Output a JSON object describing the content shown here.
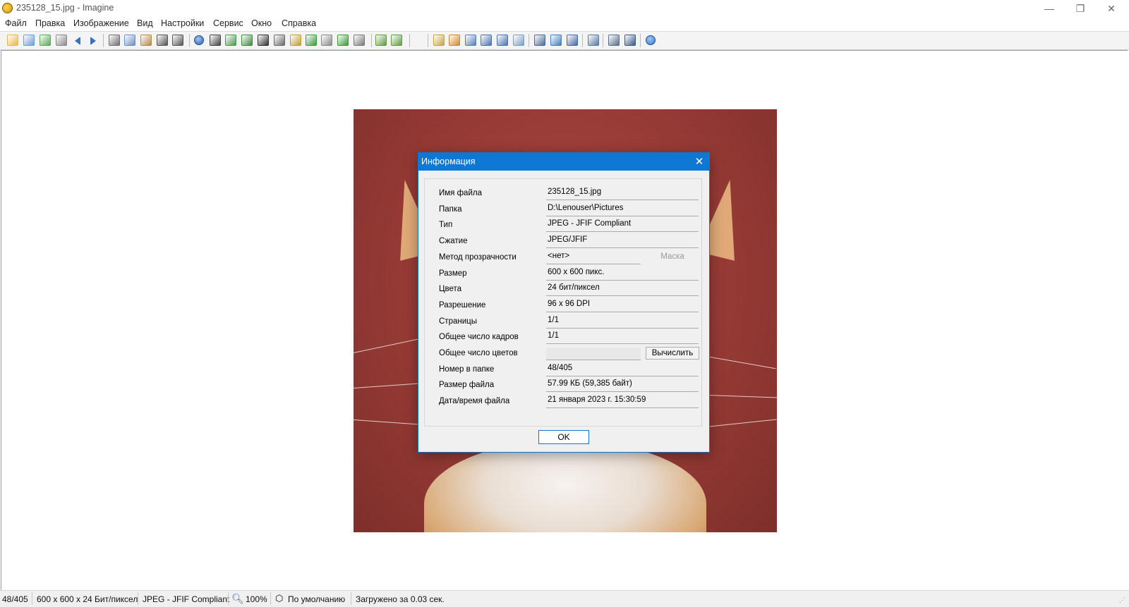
{
  "window": {
    "title": "235128_15.jpg - Imagine",
    "minimize_glyph": "—",
    "restore_glyph": "❐",
    "close_glyph": "✕"
  },
  "menu": [
    "Файл",
    "Правка",
    "Изображение",
    "Вид",
    "Настройки",
    "Сервис",
    "Окно",
    "Справка"
  ],
  "toolbar": {
    "icons": [
      "new-icon",
      "open-icon",
      "save-icon",
      "print-icon",
      "prev-icon",
      "next-icon",
      "cut-icon",
      "copy-icon",
      "paste-icon",
      "undo-icon",
      "redo-icon",
      "info-icon",
      "capture-icon",
      "resize-icon",
      "rotate-icon",
      "grayscale-icon",
      "effects-icon",
      "color-icon",
      "flip-icon",
      "crop-icon",
      "rotate-left-icon",
      "settings-icon",
      "zoom-in-icon",
      "zoom-out-icon",
      "refresh-icon",
      "thumb-icon",
      "zoom-fit-icon",
      "actual-size-icon",
      "fit-width-icon",
      "fit-height-icon",
      "monitor-icon",
      "slideshow-icon",
      "edit-icon",
      "tools-icon",
      "batch-icon",
      "convert-icon",
      "help-icon"
    ]
  },
  "dialog": {
    "title": "Информация",
    "close_glyph": "✕",
    "rows": [
      {
        "label": "Имя файла",
        "value": "235128_15.jpg"
      },
      {
        "label": "Папка",
        "value": "D:\\Lenouser\\Pictures"
      },
      {
        "label": "Тип",
        "value": "JPEG - JFIF Compliant"
      },
      {
        "label": "Сжатие",
        "value": "JPEG/JFIF"
      },
      {
        "label": "Метод прозрачности",
        "value": "<нет>",
        "button": "Маска",
        "button_enabled": false
      },
      {
        "label": "Размер",
        "value": "600 x 600 пикс."
      },
      {
        "label": "Цвета",
        "value": "24 бит/пиксел"
      },
      {
        "label": "Разрешение",
        "value": "96 x 96 DPI"
      },
      {
        "label": "Страницы",
        "value": "1/1"
      },
      {
        "label": "Общее число кадров",
        "value": "1/1"
      },
      {
        "label": "Общее число цветов",
        "value": "",
        "button": "Вычислить",
        "button_enabled": true
      },
      {
        "label": "Номер в папке",
        "value": "48/405"
      },
      {
        "label": "Размер файла",
        "value": "57.99 КБ (59,385 байт)"
      },
      {
        "label": "Дата/время файла",
        "value": "21 января 2023 г. 15:30:59"
      }
    ],
    "ok_label": "OK"
  },
  "statusbar": {
    "position": "48/405",
    "dimensions": "600 x 600 x 24 Бит/пиксел",
    "format": "JPEG - JFIF Compliant",
    "zoom": "100%",
    "mode": "По умолчанию",
    "load_time": "Загружено за 0.03 сек."
  },
  "colors": {
    "accent": "#0f78d4",
    "photo_background": "#963a35"
  }
}
